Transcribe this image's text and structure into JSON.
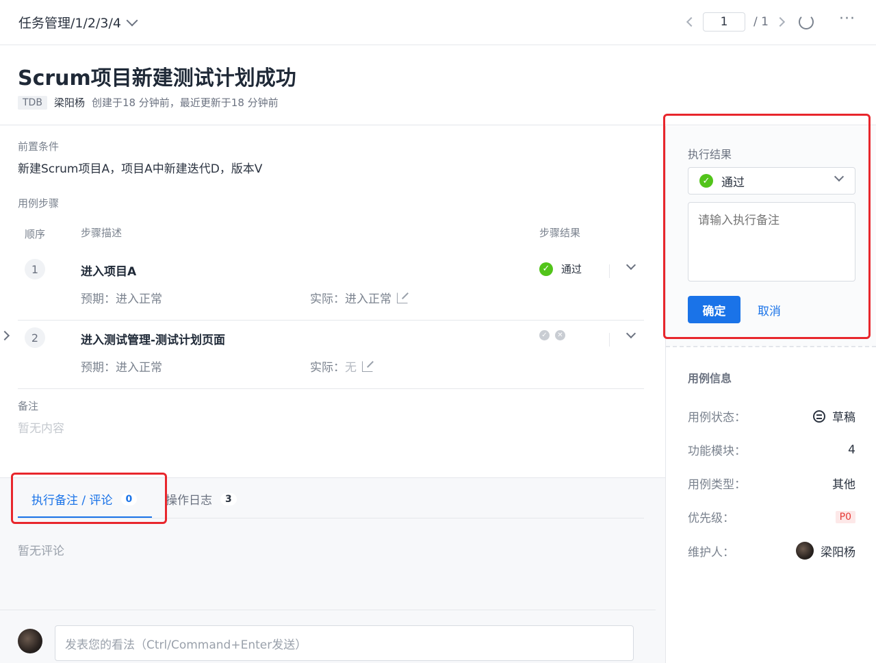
{
  "topbar": {
    "breadcrumb": "任务管理/1/2/3/4",
    "page_current": "1",
    "page_total": "/ 1",
    "more": "···"
  },
  "header": {
    "title": "Scrum项目新建测试计划成功",
    "tag": "TDB",
    "author": "梁阳杨",
    "meta_text": "创建于18 分钟前，最近更新于18 分钟前"
  },
  "precondition": {
    "label": "前置条件",
    "text": "新建Scrum项目A，项目A中新建迭代D，版本V"
  },
  "steps": {
    "label": "用例步骤",
    "col_order": "顺序",
    "col_desc": "步骤描述",
    "col_result": "步骤结果",
    "rows": [
      {
        "num": "1",
        "desc": "进入项目A",
        "expect": "预期：进入正常",
        "actual_label": "实际：",
        "actual_value": "进入正常",
        "result": "通过"
      },
      {
        "num": "2",
        "desc": "进入测试管理-测试计划页面",
        "expect": "预期：进入正常",
        "actual_label": "实际：",
        "actual_value": "无",
        "result": ""
      }
    ]
  },
  "remark": {
    "label": "备注",
    "empty": "暂无内容"
  },
  "tabs": [
    {
      "label": "执行备注 / 评论",
      "count": "0"
    },
    {
      "label": "操作日志",
      "count": "3"
    }
  ],
  "comments": {
    "empty": "暂无评论",
    "placeholder": "发表您的看法（Ctrl/Command+Enter发送）"
  },
  "exec": {
    "label": "执行结果",
    "selected": "通过",
    "note_placeholder": "请输入执行备注",
    "ok": "确定",
    "cancel": "取消"
  },
  "info": {
    "title": "用例信息",
    "rows": [
      {
        "k": "用例状态：",
        "v": "草稿"
      },
      {
        "k": "功能模块：",
        "v": "4"
      },
      {
        "k": "用例类型：",
        "v": "其他"
      },
      {
        "k": "优先级：",
        "v": "P0"
      },
      {
        "k": "维护人：",
        "v": "梁阳杨"
      }
    ]
  },
  "colors": {
    "accent": "#1a73e8",
    "success": "#52c41a",
    "annotation": "#e8262c"
  }
}
